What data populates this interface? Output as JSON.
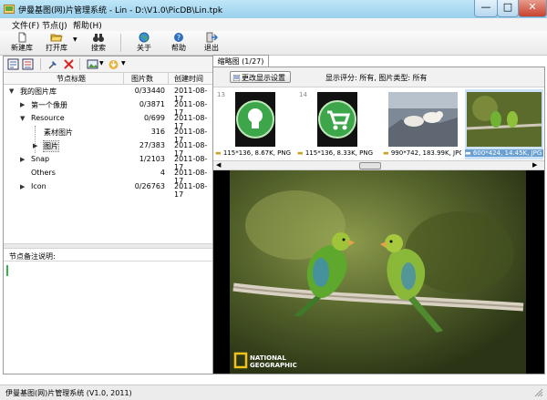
{
  "window": {
    "title": "伊曼基图(网)片管理系统 - Lin - D:\\V1.0\\PicDB\\Lin.tpk",
    "controls": {
      "minimize": "—",
      "maximize": "□",
      "close": "✕"
    }
  },
  "menu": [
    "文件(F)",
    "节点(J)",
    "帮助(H)"
  ],
  "toolbar": {
    "items": [
      {
        "label": "新建库",
        "icon": "new-file-icon"
      },
      {
        "label": "打开库",
        "icon": "open-folder-icon"
      },
      {
        "label": "搜索",
        "icon": "binoculars-icon"
      },
      {
        "label": "关于",
        "icon": "globe-icon"
      },
      {
        "label": "帮助",
        "icon": "help-icon"
      },
      {
        "label": "退出",
        "icon": "exit-icon"
      }
    ]
  },
  "tree": {
    "headers": {
      "name": "节点标题",
      "count": "图片数",
      "date": "创建时间"
    },
    "rows": [
      {
        "name": "我的图片库",
        "count": "0/33440",
        "date": "2011-08-17",
        "expander": "▼"
      },
      {
        "name": "第一个像册",
        "count": "0/3871",
        "date": "2011-08-17",
        "expander": "▶"
      },
      {
        "name": "Resource",
        "count": "0/699",
        "date": "2011-08-17",
        "expander": "▼"
      },
      {
        "name": "素材图片",
        "count": "316",
        "date": "2011-08-17",
        "expander": ""
      },
      {
        "name": "图片",
        "count": "27/383",
        "date": "2011-08-17",
        "expander": "▶"
      },
      {
        "name": "Snap",
        "count": "1/2103",
        "date": "2011-08-17",
        "expander": "▶"
      },
      {
        "name": "Others",
        "count": "4",
        "date": "2011-08-17",
        "expander": ""
      },
      {
        "name": "Icon",
        "count": "0/26763",
        "date": "2011-08-17",
        "expander": "▶"
      }
    ]
  },
  "notes": {
    "label": "节点备注说明:"
  },
  "thumbs": {
    "tab_label": "缩略图 (1/27)",
    "change_button": "更改显示设置",
    "filter_text": "显示评分: 所有, 图片类型: 所有",
    "items": [
      {
        "num": "13",
        "caption": "115*136, 8.67K, PNG"
      },
      {
        "num": "14",
        "caption": "115*136, 8.33K, PNG"
      },
      {
        "num": "",
        "caption": "990*742, 183.99K, JPG"
      },
      {
        "num": "16",
        "caption": "600*424, 14.45K, JPG"
      }
    ]
  },
  "preview": {
    "watermark_line1": "NATIONAL",
    "watermark_line2": "GEOGRAPHIC"
  },
  "status": {
    "text": "伊曼基图(网)片管理系统 (V1.0, 2011)"
  },
  "colors": {
    "titlebar": "#9ad0ec",
    "selection": "#6aa1d2",
    "accent_green": "#2fb34a"
  }
}
